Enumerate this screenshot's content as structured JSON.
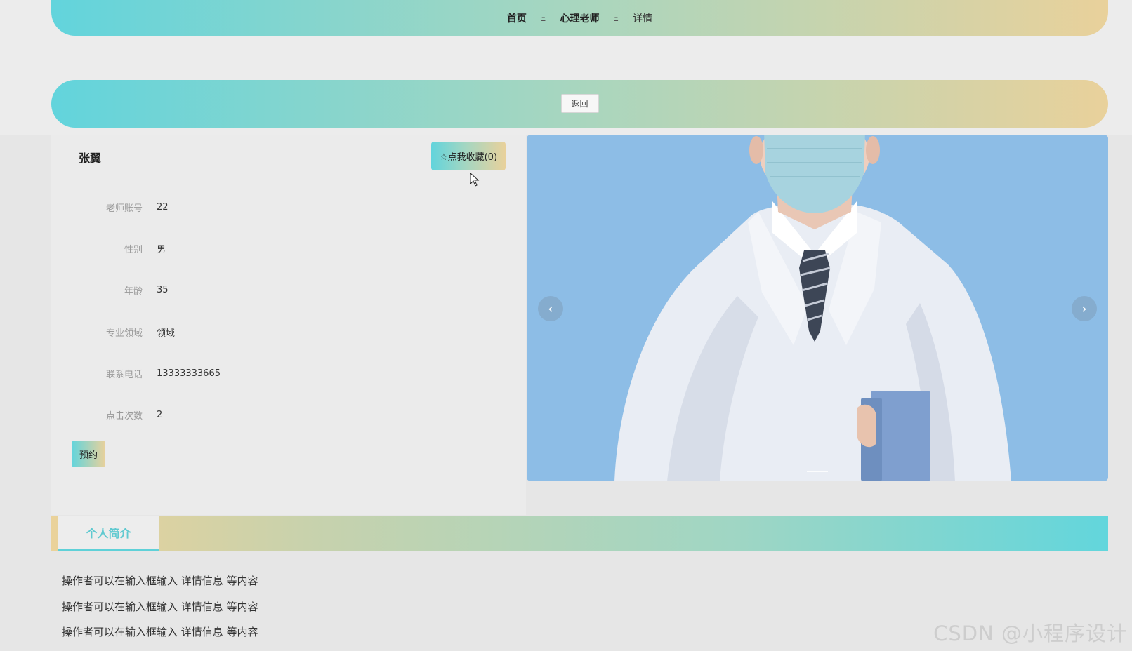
{
  "breadcrumb": {
    "items": [
      "首页",
      "心理老师",
      "详情"
    ],
    "separator": "Ξ"
  },
  "back_label": "返回",
  "teacher": {
    "name": "张翼",
    "favorite_label": "☆点我收藏(0)",
    "fields": [
      {
        "label": "老师账号",
        "value": "22"
      },
      {
        "label": "性别",
        "value": "男"
      },
      {
        "label": "年龄",
        "value": "35"
      },
      {
        "label": "专业领域",
        "value": "领域"
      },
      {
        "label": "联系电话",
        "value": "13333333665"
      },
      {
        "label": "点击次数",
        "value": "2"
      }
    ],
    "appointment_label": "预约"
  },
  "carousel": {
    "prev_icon": "‹",
    "next_icon": "›"
  },
  "tabs": [
    {
      "label": "个人简介"
    }
  ],
  "intro_lines": [
    "操作者可以在输入框输入  详情信息  等内容",
    "操作者可以在输入框输入  详情信息  等内容",
    "操作者可以在输入框输入  详情信息  等内容"
  ],
  "watermark": "CSDN @小程序设计",
  "colors": {
    "gradient_start": "#62d4dc",
    "gradient_end": "#e9d19b",
    "tab_accent": "#5fd1d8",
    "carousel_bg": "#8dbde6"
  }
}
